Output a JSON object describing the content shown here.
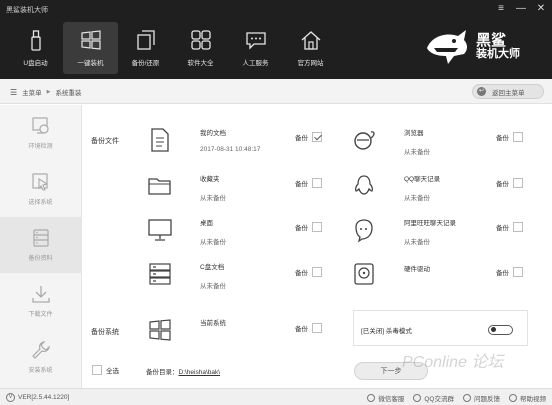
{
  "window": {
    "title": "黑鲨装机大师",
    "controls": [
      "≡",
      "—",
      "✕"
    ]
  },
  "nav": [
    {
      "label": "U盘启动",
      "icon": "usb-icon"
    },
    {
      "label": "一键装机",
      "icon": "windows-icon"
    },
    {
      "label": "备份/还原",
      "icon": "backup-restore-icon"
    },
    {
      "label": "软件大全",
      "icon": "apps-grid-icon"
    },
    {
      "label": "人工服务",
      "icon": "chat-icon"
    },
    {
      "label": "官方网站",
      "icon": "home-icon"
    }
  ],
  "logo": {
    "line1": "黑鲨",
    "line2": "装机大师"
  },
  "breadcrumb": {
    "home": "主菜单",
    "separator": "▶",
    "current": "系统重装"
  },
  "back_button": {
    "label": "返回主菜单"
  },
  "steps": [
    {
      "label": "环境检测",
      "icon": "monitor-check-icon"
    },
    {
      "label": "选择系统",
      "icon": "cursor-select-icon"
    },
    {
      "label": "备份资料",
      "icon": "backup-data-icon"
    },
    {
      "label": "下载文件",
      "icon": "download-icon"
    },
    {
      "label": "安装系统",
      "icon": "wrench-icon"
    }
  ],
  "backup": {
    "files_section": "备份文件",
    "system_section": "备份系统",
    "backup_label": "备份",
    "items": [
      {
        "name": "我的文档",
        "sub": "2017-08-31 10:48:17",
        "checked": true,
        "icon": "document-icon"
      },
      {
        "name": "浏览器",
        "sub": "从未备份",
        "checked": false,
        "icon": "browser-icon"
      },
      {
        "name": "收藏夹",
        "sub": "从未备份",
        "checked": false,
        "icon": "folder-icon"
      },
      {
        "name": "QQ聊天记录",
        "sub": "从未备份",
        "checked": false,
        "icon": "qq-icon"
      },
      {
        "name": "桌面",
        "sub": "从未备份",
        "checked": false,
        "icon": "desktop-icon"
      },
      {
        "name": "阿里旺旺聊天记录",
        "sub": "从未备份",
        "checked": false,
        "icon": "wangwang-icon"
      },
      {
        "name": "C盘文档",
        "sub": "从未备份",
        "checked": false,
        "icon": "drive-icon"
      },
      {
        "name": "硬件驱动",
        "sub": "",
        "checked": false,
        "icon": "hardware-driver-icon"
      }
    ],
    "system_item": {
      "name": "当前系统",
      "checked": false,
      "icon": "windows-icon"
    },
    "antivirus": {
      "label": "[已关闭] 杀毒模式",
      "enabled": false
    }
  },
  "footer_row": {
    "select_all": "全选",
    "dir_label": "备份目录：",
    "dir_path": "D:\\heisha\\bak\\",
    "next_button": "下一步",
    "watermark": "PConline 论坛"
  },
  "status": {
    "version": "VER[2.5.44.1220]",
    "links": [
      "微信客服",
      "QQ交流群",
      "问题反馈",
      "帮助视频"
    ]
  }
}
